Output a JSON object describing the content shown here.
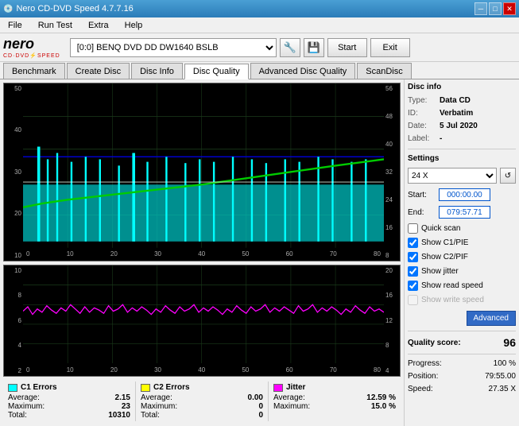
{
  "titleBar": {
    "title": "Nero CD-DVD Speed 4.7.7.16",
    "controls": [
      "minimize",
      "maximize",
      "close"
    ]
  },
  "menuBar": {
    "items": [
      "File",
      "Run Test",
      "Extra",
      "Help"
    ]
  },
  "toolbar": {
    "driveLabel": "[0:0]  BENQ DVD DD DW1640 BSLB",
    "startLabel": "Start",
    "exitLabel": "Exit"
  },
  "tabs": [
    {
      "label": "Benchmark",
      "active": false
    },
    {
      "label": "Create Disc",
      "active": false
    },
    {
      "label": "Disc Info",
      "active": false
    },
    {
      "label": "Disc Quality",
      "active": true
    },
    {
      "label": "Advanced Disc Quality",
      "active": false
    },
    {
      "label": "ScanDisc",
      "active": false
    }
  ],
  "charts": {
    "top": {
      "yLeft": [
        "50",
        "40",
        "30",
        "20",
        "10"
      ],
      "yRight": [
        "56",
        "48",
        "40",
        "32",
        "24",
        "16",
        "8"
      ],
      "xLabels": [
        "0",
        "10",
        "20",
        "30",
        "40",
        "50",
        "60",
        "70",
        "80"
      ]
    },
    "bottom": {
      "yLeft": [
        "10",
        "8",
        "6",
        "4",
        "2"
      ],
      "yRight": [
        "20",
        "16",
        "12",
        "8",
        "4"
      ],
      "xLabels": [
        "0",
        "10",
        "20",
        "30",
        "40",
        "50",
        "60",
        "70",
        "80"
      ]
    }
  },
  "stats": {
    "c1": {
      "label": "C1 Errors",
      "color": "#00ffff",
      "average": "2.15",
      "maximum": "23",
      "total": "10310"
    },
    "c2": {
      "label": "C2 Errors",
      "color": "#ffff00",
      "average": "0.00",
      "maximum": "0",
      "total": "0"
    },
    "jitter": {
      "label": "Jitter",
      "color": "#ff00ff",
      "average": "12.59 %",
      "maximum": "15.0 %"
    }
  },
  "discInfo": {
    "title": "Disc info",
    "type": {
      "label": "Type:",
      "value": "Data CD"
    },
    "id": {
      "label": "ID:",
      "value": "Verbatim"
    },
    "date": {
      "label": "Date:",
      "value": "5 Jul 2020"
    },
    "label": {
      "label": "Label:",
      "value": "-"
    }
  },
  "settings": {
    "title": "Settings",
    "speed": "24 X",
    "startLabel": "Start:",
    "startValue": "000:00.00",
    "endLabel": "End:",
    "endValue": "079:57.71",
    "quickScan": {
      "label": "Quick scan",
      "checked": false
    },
    "showC1PIE": {
      "label": "Show C1/PIE",
      "checked": true
    },
    "showC2PIF": {
      "label": "Show C2/PIF",
      "checked": true
    },
    "showJitter": {
      "label": "Show jitter",
      "checked": true
    },
    "showReadSpeed": {
      "label": "Show read speed",
      "checked": true
    },
    "showWriteSpeed": {
      "label": "Show write speed",
      "checked": false
    },
    "advancedLabel": "Advanced"
  },
  "results": {
    "qualityScore": {
      "label": "Quality score:",
      "value": "96"
    },
    "progress": {
      "label": "Progress:",
      "value": "100 %"
    },
    "position": {
      "label": "Position:",
      "value": "79:55.00"
    },
    "speed": {
      "label": "Speed:",
      "value": "27.35 X"
    }
  },
  "labels": {
    "average": "Average:",
    "maximum": "Maximum:",
    "total": "Total:"
  }
}
